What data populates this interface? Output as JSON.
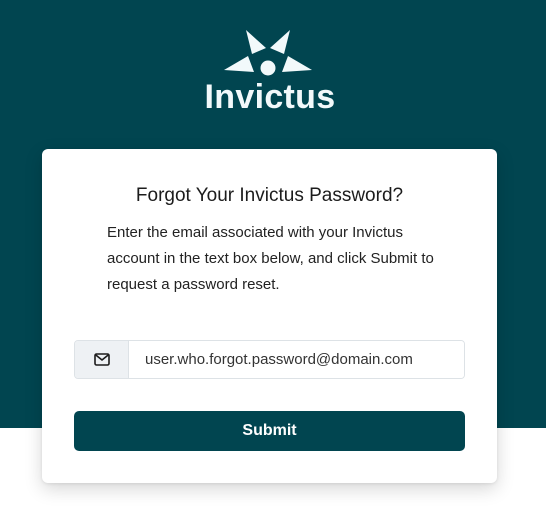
{
  "brand": {
    "name": "Invictus",
    "primary_color": "#014550",
    "logo_color": "#f2f9fb"
  },
  "card": {
    "title": "Forgot Your Invictus Password?",
    "description": "Enter the email associated with your Invictus account in the text box below, and click Submit to request a password reset."
  },
  "form": {
    "email_icon": "envelope-icon",
    "email_value": "user.who.forgot.password@domain.com",
    "submit_label": "Submit"
  }
}
